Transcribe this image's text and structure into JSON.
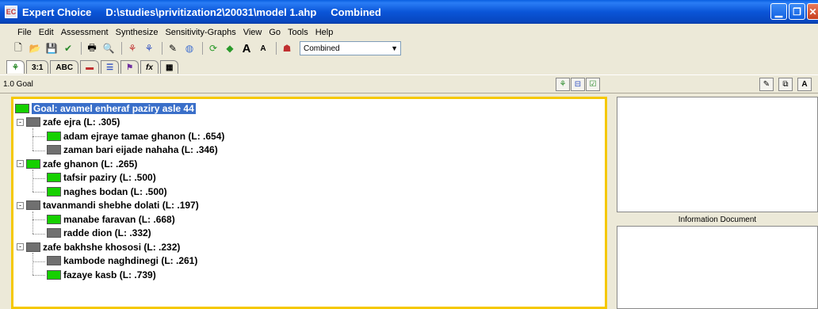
{
  "window": {
    "app_name": "Expert Choice",
    "file_path": "D:\\studies\\privitization2\\20031\\model 1.ahp",
    "mode": "Combined",
    "app_icon_text": "EC"
  },
  "menu": [
    "File",
    "Edit",
    "Assessment",
    "Synthesize",
    "Sensitivity-Graphs",
    "View",
    "Go",
    "Tools",
    "Help"
  ],
  "toolbar": {
    "combo_value": "Combined"
  },
  "tabs": [
    "",
    "3:1",
    "ABC",
    "",
    "",
    "",
    "fx",
    ""
  ],
  "header": {
    "goal_label": "1.0 Goal"
  },
  "tree": [
    {
      "label": "Goal: avamel enheraf paziry asle 44",
      "level": 0,
      "color": "green",
      "selected": true
    },
    {
      "label": "zafe ejra (L: .305)",
      "level": 1,
      "color": "gray",
      "expander": "-"
    },
    {
      "label": "adam ejraye tamae ghanon (L: .654)",
      "level": 2,
      "color": "green"
    },
    {
      "label": "zaman bari eijade nahaha (L: .346)",
      "level": 2,
      "color": "gray"
    },
    {
      "label": "zafe ghanon (L: .265)",
      "level": 1,
      "color": "green",
      "expander": "-"
    },
    {
      "label": "tafsir paziry (L: .500)",
      "level": 2,
      "color": "green"
    },
    {
      "label": "naghes bodan (L: .500)",
      "level": 2,
      "color": "green"
    },
    {
      "label": "tavanmandi shebhe dolati (L: .197)",
      "level": 1,
      "color": "gray",
      "expander": "-"
    },
    {
      "label": "manabe faravan (L: .668)",
      "level": 2,
      "color": "green"
    },
    {
      "label": "radde dion (L: .332)",
      "level": 2,
      "color": "gray"
    },
    {
      "label": "zafe bakhshe khososi (L: .232)",
      "level": 1,
      "color": "gray",
      "expander": "-"
    },
    {
      "label": "kambode naghdinegi (L: .261)",
      "level": 2,
      "color": "gray"
    },
    {
      "label": "fazaye kasb (L: .739)",
      "level": 2,
      "color": "green"
    }
  ],
  "right": {
    "info_label": "Information Document"
  },
  "colors": {
    "green": "#16d000",
    "gray": "#707070",
    "selection": "#3a6fc9",
    "frame": "#f5c800"
  }
}
